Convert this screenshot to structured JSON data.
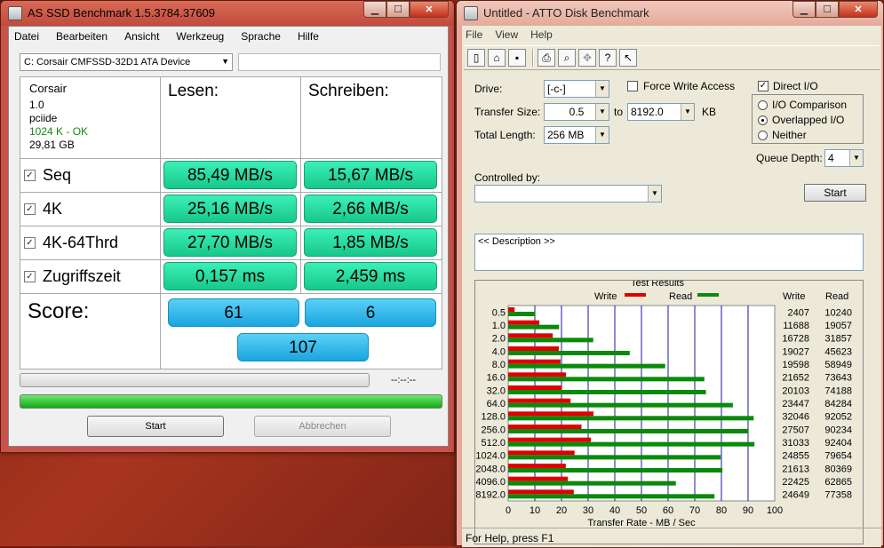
{
  "asssd": {
    "title": "AS SSD Benchmark 1.5.3784.37609",
    "menu": [
      "Datei",
      "Bearbeiten",
      "Ansicht",
      "Werkzeug",
      "Sprache",
      "Hilfe"
    ],
    "device": "C: Corsair CMFSSD-32D1 ATA Device",
    "info": {
      "vendor": "Corsair",
      "version": "1.0",
      "driver": "pciide",
      "align": "1024 K - OK",
      "size": "29,81 GB"
    },
    "read_header": "Lesen:",
    "write_header": "Schreiben:",
    "rows": [
      {
        "label": "Seq",
        "read": "85,49 MB/s",
        "write": "15,67 MB/s"
      },
      {
        "label": "4K",
        "read": "25,16 MB/s",
        "write": "2,66 MB/s"
      },
      {
        "label": "4K-64Thrd",
        "read": "27,70 MB/s",
        "write": "1,85 MB/s"
      },
      {
        "label": "Zugriffszeit",
        "read": "0,157 ms",
        "write": "2,459 ms"
      }
    ],
    "score_label": "Score:",
    "score_read": "61",
    "score_write": "6",
    "score_total": "107",
    "time": "--:--:--",
    "start": "Start",
    "cancel": "Abbrechen"
  },
  "atto": {
    "title": "Untitled - ATTO Disk Benchmark",
    "menu": [
      "File",
      "View",
      "Help"
    ],
    "drive_label": "Drive:",
    "drive": "[-c-]",
    "force_write": "Force Write Access",
    "direct_io": "Direct I/O",
    "transfer_label": "Transfer Size:",
    "transfer_from": "0.5",
    "to": "to",
    "transfer_to": "8192.0",
    "kb": "KB",
    "length_label": "Total Length:",
    "length": "256 MB",
    "io_comparison": "I/O Comparison",
    "overlapped": "Overlapped I/O",
    "neither": "Neither",
    "queue_label": "Queue Depth:",
    "queue": "4",
    "controlled_label": "Controlled by:",
    "start": "Start",
    "description": "<< Description >>",
    "results_title": "Test Results",
    "write_legend": "Write",
    "read_legend": "Read",
    "col_write": "Write",
    "col_read": "Read",
    "xlabel": "Transfer Rate - MB / Sec",
    "status": "For Help, press F1",
    "colors": {
      "write": "#e00000",
      "read": "#0a8a0a"
    }
  },
  "chart_data": {
    "type": "bar",
    "title": "Test Results",
    "xlabel": "Transfer Rate - MB / Sec",
    "xlim": [
      0,
      100
    ],
    "xticks": [
      "0",
      "10",
      "20",
      "30",
      "40",
      "50",
      "60",
      "70",
      "80",
      "90",
      "100"
    ],
    "categories": [
      "0.5",
      "1.0",
      "2.0",
      "4.0",
      "8.0",
      "16.0",
      "32.0",
      "64.0",
      "128.0",
      "256.0",
      "512.0",
      "1024.0",
      "2048.0",
      "4096.0",
      "8192.0"
    ],
    "write_text": [
      "2407",
      "11688",
      "16728",
      "19027",
      "19598",
      "21652",
      "20103",
      "23447",
      "32046",
      "27507",
      "31033",
      "24855",
      "21613",
      "22425",
      "24649"
    ],
    "read_text": [
      "10240",
      "19057",
      "31857",
      "45623",
      "58949",
      "73643",
      "74188",
      "84284",
      "92052",
      "90234",
      "92404",
      "79654",
      "80369",
      "62865",
      "77358"
    ],
    "series": [
      {
        "name": "Write",
        "values": [
          2.4,
          11.7,
          16.7,
          19.0,
          19.6,
          21.7,
          20.1,
          23.4,
          32.0,
          27.5,
          31.0,
          24.9,
          21.6,
          22.4,
          24.6
        ]
      },
      {
        "name": "Read",
        "values": [
          10.2,
          19.1,
          31.9,
          45.6,
          58.9,
          73.6,
          74.2,
          84.3,
          92.1,
          90.2,
          92.4,
          79.7,
          80.4,
          62.9,
          77.4
        ]
      }
    ]
  }
}
